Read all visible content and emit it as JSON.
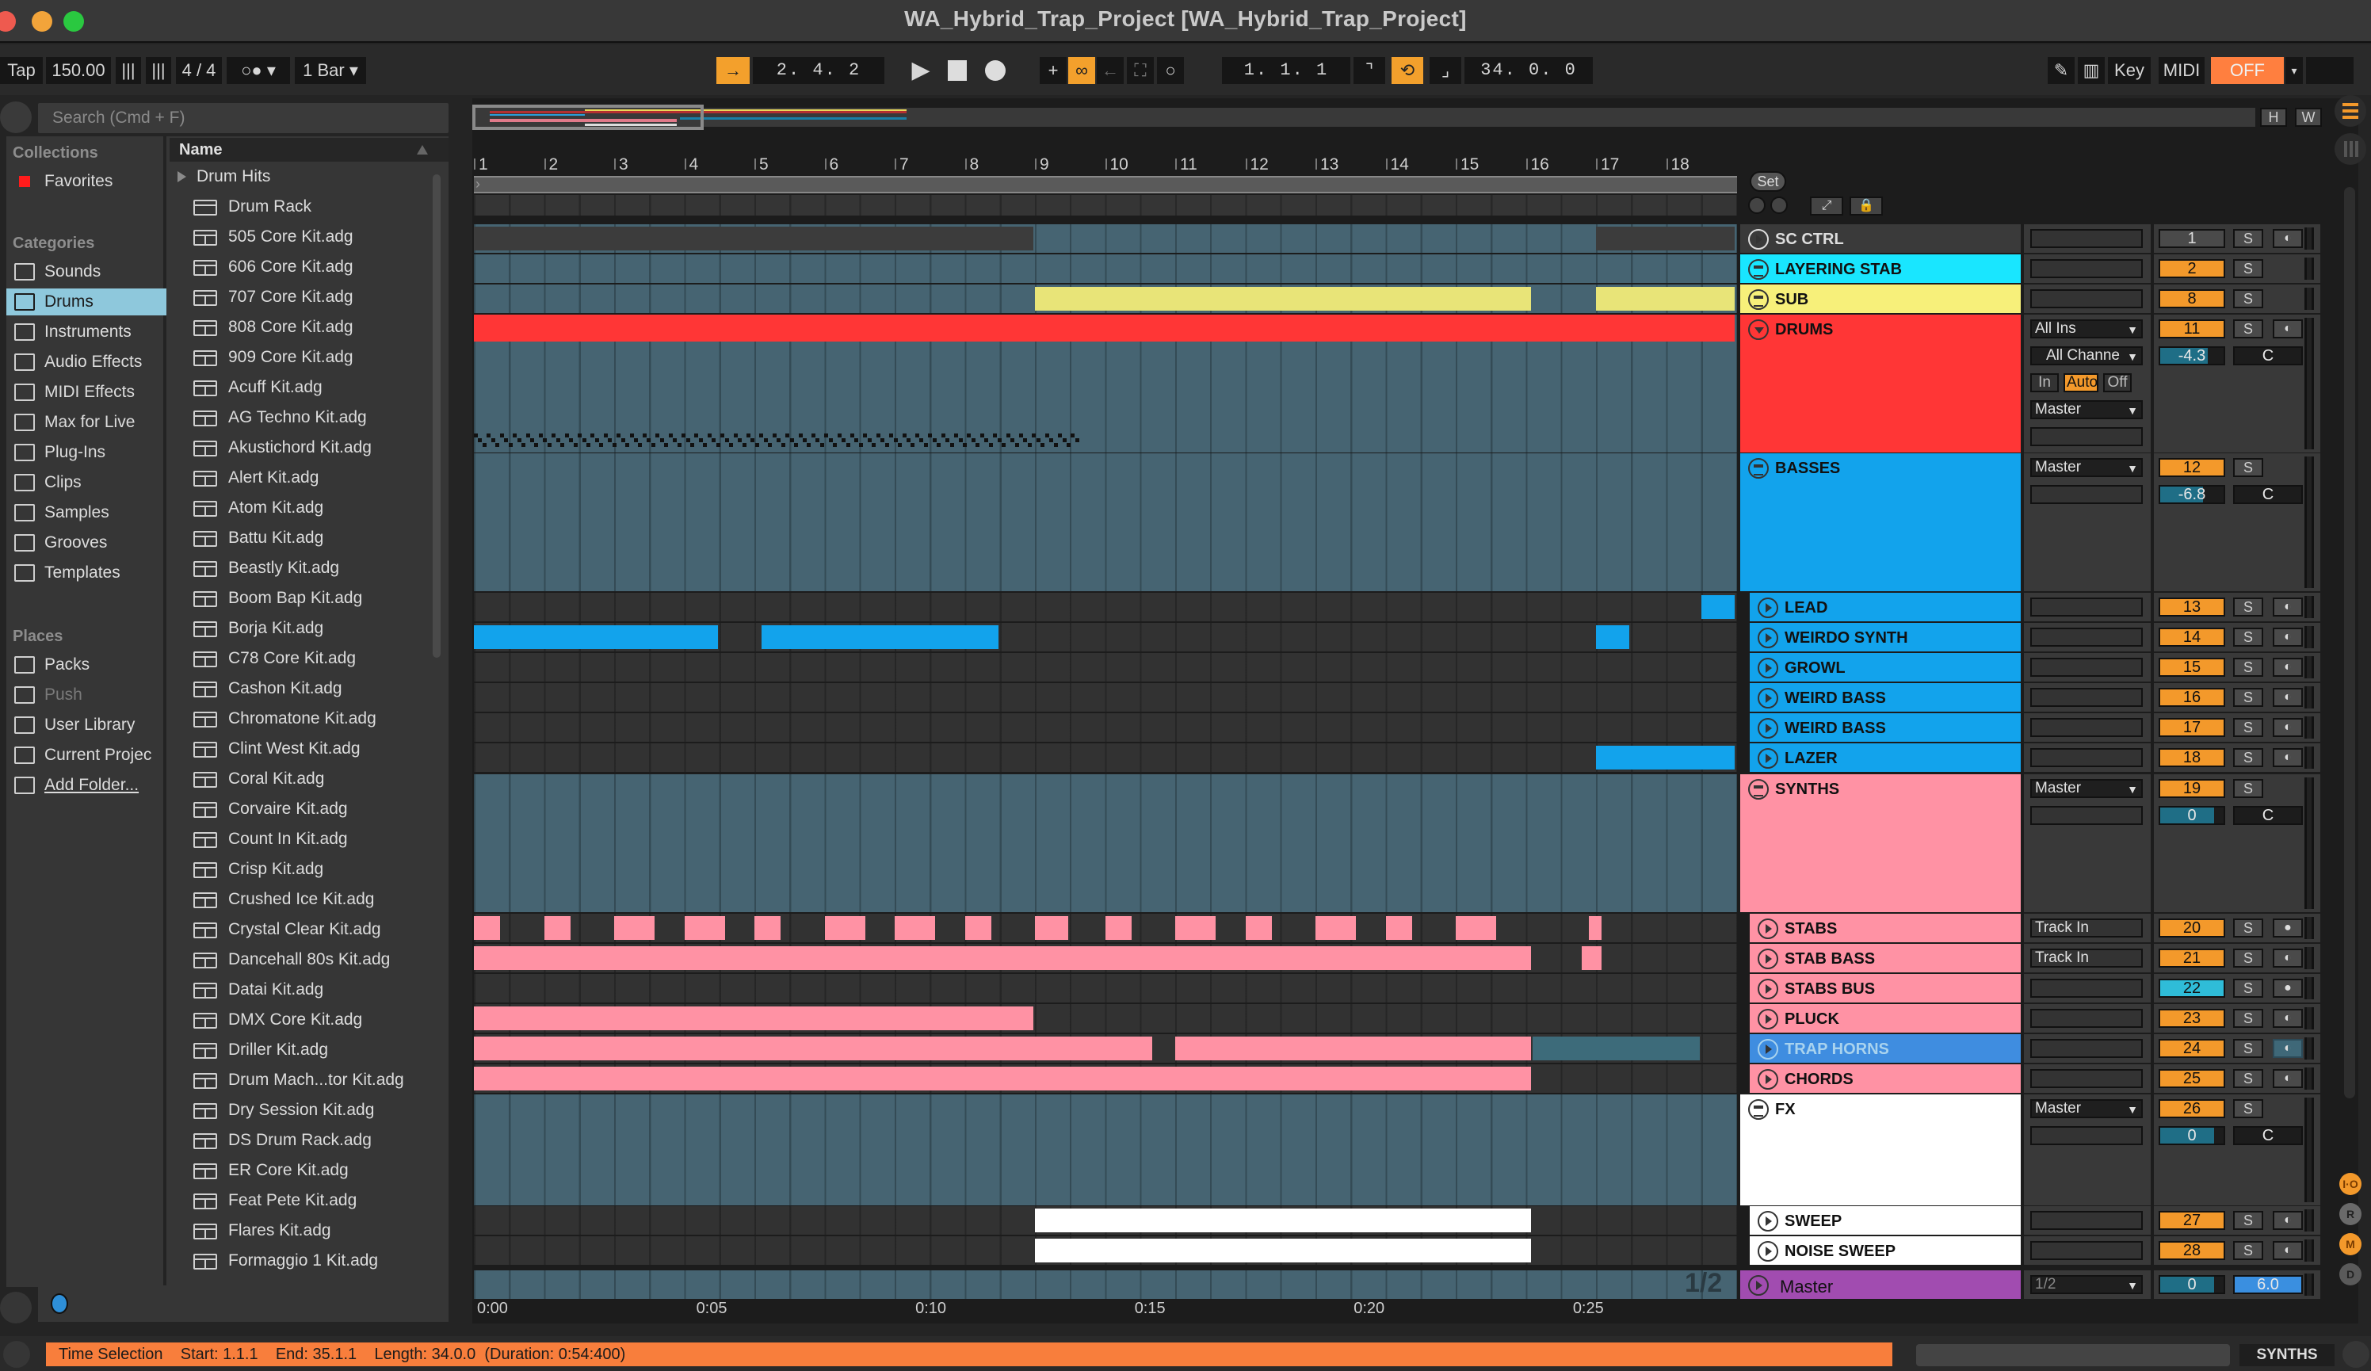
{
  "window": {
    "title": "WA_Hybrid_Trap_Project  [WA_Hybrid_Trap_Project]"
  },
  "transport": {
    "tap_label": "Tap",
    "tempo": "150.00",
    "time_signature": "4 / 4",
    "quantize": "1 Bar",
    "position": "2.  4.  2",
    "loop_start": "1.  1.  1",
    "loop_length": "34.  0.  0",
    "key_label": "Key",
    "midi_label": "MIDI",
    "cpu_off_label": "OFF"
  },
  "browser": {
    "search_placeholder": "Search (Cmd + F)",
    "collections_heading": "Collections",
    "favorites_label": "Favorites",
    "categories_heading": "Categories",
    "categories": [
      {
        "label": "Sounds",
        "icon": "music-note-icon"
      },
      {
        "label": "Drums",
        "icon": "drum-grid-icon",
        "selected": true
      },
      {
        "label": "Instruments",
        "icon": "instrument-knob-icon"
      },
      {
        "label": "Audio Effects",
        "icon": "audio-waveform-icon"
      },
      {
        "label": "MIDI Effects",
        "icon": "midi-lines-icon"
      },
      {
        "label": "Max for Live",
        "icon": "max-for-live-icon"
      },
      {
        "label": "Plug-Ins",
        "icon": "plug-icon"
      },
      {
        "label": "Clips",
        "icon": "clip-play-icon"
      },
      {
        "label": "Samples",
        "icon": "sample-wave-icon"
      },
      {
        "label": "Grooves",
        "icon": "groove-wave-icon"
      },
      {
        "label": "Templates",
        "icon": "template-icon"
      }
    ],
    "places_heading": "Places",
    "places": [
      {
        "label": "Packs",
        "icon": "packs-icon"
      },
      {
        "label": "Push",
        "icon": "push-icon",
        "dim": true
      },
      {
        "label": "User Library",
        "icon": "user-icon"
      },
      {
        "label": "Current Projec",
        "icon": "project-folder-icon"
      },
      {
        "label": "Add Folder...",
        "icon": "add-folder-icon",
        "link": true
      }
    ],
    "column_header": "Name",
    "folder": "Drum Hits",
    "files": [
      "Drum Rack",
      "505 Core Kit.adg",
      "606 Core Kit.adg",
      "707 Core Kit.adg",
      "808 Core Kit.adg",
      "909 Core Kit.adg",
      "Acuff Kit.adg",
      "AG Techno Kit.adg",
      "Akustichord Kit.adg",
      "Alert Kit.adg",
      "Atom Kit.adg",
      "Battu Kit.adg",
      "Beastly Kit.adg",
      "Boom Bap Kit.adg",
      "Borja Kit.adg",
      "C78 Core Kit.adg",
      "Cashon Kit.adg",
      "Chromatone Kit.adg",
      "Clint West Kit.adg",
      "Coral Kit.adg",
      "Corvaire Kit.adg",
      "Count In Kit.adg",
      "Crisp Kit.adg",
      "Crushed Ice Kit.adg",
      "Crystal Clear Kit.adg",
      "Dancehall 80s Kit.adg",
      "Datai Kit.adg",
      "DMX Core Kit.adg",
      "Driller Kit.adg",
      "Drum Mach...tor Kit.adg",
      "Dry Session Kit.adg",
      "DS Drum Rack.adg",
      "ER Core Kit.adg",
      "Feat Pete Kit.adg",
      "Flares Kit.adg",
      "Formaggio 1 Kit.adg"
    ]
  },
  "arrangement": {
    "bar_numbers": [
      "1",
      "2",
      "3",
      "4",
      "5",
      "6",
      "7",
      "8",
      "9",
      "10",
      "11",
      "12",
      "13",
      "14",
      "15",
      "16",
      "17",
      "18"
    ],
    "set_label": "Set",
    "h_label": "H",
    "w_label": "W",
    "time_labels": [
      "0:00",
      "0:05",
      "0:10",
      "0:15",
      "0:20",
      "0:25"
    ],
    "page_indicator": "1/2"
  },
  "tracks": [
    {
      "name": "SC CTRL",
      "number": "1",
      "color": "#3a3a3a",
      "textColor": "#dddddd",
      "kind": "midi",
      "arm": true,
      "numStyle": "grey"
    },
    {
      "name": "LAYERING STAB",
      "number": "2",
      "color": "#19e6ff",
      "kind": "group-collapsed"
    },
    {
      "name": "SUB",
      "number": "8",
      "color": "#f7f07a",
      "kind": "group-collapsed"
    },
    {
      "name": "DRUMS",
      "number": "11",
      "color": "#ff3636",
      "kind": "group-open",
      "arm": true,
      "input_type": "All Ins",
      "input_channel": "All Channe",
      "monitor": [
        "In",
        "Auto",
        "Off"
      ],
      "output": "Master",
      "volume": "-4.3",
      "volume_fraction": 0.75,
      "pan": "C"
    },
    {
      "name": "BASSES",
      "number": "12",
      "color": "#12a3ec",
      "kind": "group",
      "output": "Master",
      "volume": "-6.8",
      "volume_fraction": 0.68,
      "pan": "C"
    },
    {
      "name": "LEAD",
      "number": "13",
      "color": "#12a3ec",
      "kind": "child",
      "arm": true
    },
    {
      "name": "WEIRDO SYNTH",
      "number": "14",
      "color": "#12a3ec",
      "kind": "child",
      "arm": true
    },
    {
      "name": "GROWL",
      "number": "15",
      "color": "#12a3ec",
      "kind": "child",
      "arm": true
    },
    {
      "name": "WEIRD BASS",
      "number": "16",
      "color": "#12a3ec",
      "kind": "child",
      "arm": true
    },
    {
      "name": "WEIRD BASS",
      "number": "17",
      "color": "#12a3ec",
      "kind": "child",
      "arm": true
    },
    {
      "name": "LAZER",
      "number": "18",
      "color": "#12a3ec",
      "kind": "child",
      "arm": true
    },
    {
      "name": "SYNTHS",
      "number": "19",
      "color": "#ff92a4",
      "kind": "group",
      "output": "Master",
      "volume": "0",
      "volume_fraction": 0.85,
      "pan": "C"
    },
    {
      "name": "STABS",
      "number": "20",
      "color": "#ff92a4",
      "kind": "child",
      "arm": true,
      "input": "Track In",
      "armIcon": "dot"
    },
    {
      "name": "STAB BASS",
      "number": "21",
      "color": "#ff92a4",
      "kind": "child",
      "arm": true,
      "input": "Track In"
    },
    {
      "name": "STABS BUS",
      "number": "22",
      "color": "#ff92a4",
      "kind": "child",
      "arm": true,
      "armIcon": "dot",
      "numStyle": "cyan"
    },
    {
      "name": "PLUCK",
      "number": "23",
      "color": "#ff92a4",
      "kind": "child",
      "arm": true
    },
    {
      "name": "TRAP HORNS",
      "number": "24",
      "color": "#3f8de0",
      "textColor": "#a9d3ee",
      "kind": "child",
      "arm": true,
      "selected": true
    },
    {
      "name": "CHORDS",
      "number": "25",
      "color": "#ff92a4",
      "kind": "child",
      "arm": true
    },
    {
      "name": "FX",
      "number": "26",
      "color": "#ffffff",
      "kind": "group",
      "output": "Master",
      "volume": "0",
      "volume_fraction": 0.85,
      "pan": "C"
    },
    {
      "name": "SWEEP",
      "number": "27",
      "color": "#ffffff",
      "kind": "child",
      "arm": true
    },
    {
      "name": "NOISE SWEEP",
      "number": "28",
      "color": "#ffffff",
      "kind": "child",
      "arm": true
    }
  ],
  "master": {
    "name": "Master",
    "output": "1/2",
    "volume": "0",
    "volume_fraction": 0.85,
    "pan_value": "6.0",
    "color": "#a14cb0"
  },
  "side_buttons": [
    "I·O",
    "R",
    "M",
    "D"
  ],
  "status": {
    "text": "Time Selection    Start: 1.1.1    End: 35.1.1    Length: 34.0.0  (Duration: 0:54:400)",
    "track_label": "SYNTHS"
  },
  "colors": {
    "accent_orange": "#f3992b",
    "cpu_off": "#ff7f3f",
    "status_bar": "#f87e3c",
    "lane_bg": "#466472"
  }
}
